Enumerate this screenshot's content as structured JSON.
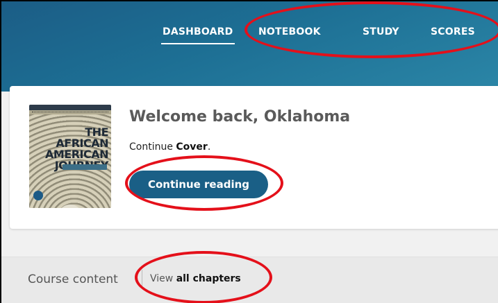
{
  "nav": {
    "tabs": [
      {
        "label": "DASHBOARD",
        "active": true
      },
      {
        "label": "NOTEBOOK",
        "active": false
      },
      {
        "label": "STUDY",
        "active": false
      },
      {
        "label": "SCORES",
        "active": false
      }
    ]
  },
  "book": {
    "cover_title": "THE AFRICAN AMERICAN JOURNEY"
  },
  "welcome": {
    "greeting": "Welcome back, Oklahoma",
    "continue_prefix": "Continue ",
    "continue_location": "Cover",
    "continue_suffix": ".",
    "continue_button": "Continue reading"
  },
  "course": {
    "label": "Course content",
    "view_prefix": "View ",
    "view_link": "all chapters"
  },
  "colors": {
    "header": "#1d6f94",
    "button": "#1a5f86",
    "annotation": "#e4101a"
  }
}
